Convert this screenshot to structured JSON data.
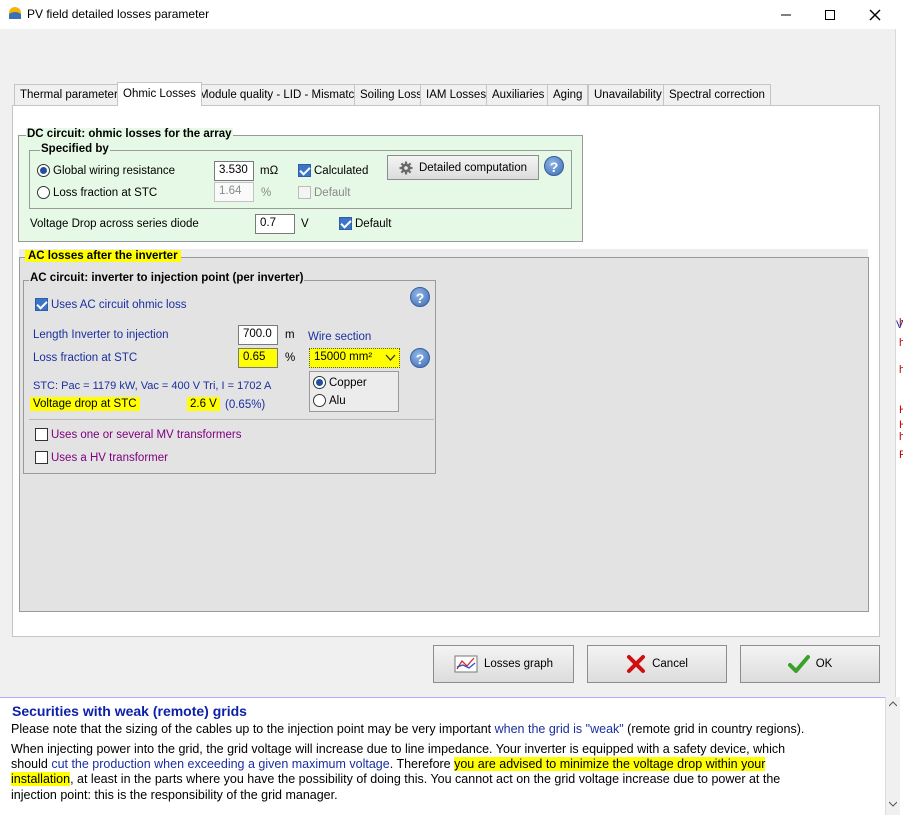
{
  "window": {
    "title": "PV field detailed losses parameter",
    "minimize_glyph": "—",
    "maximize_glyph": "☐",
    "close_glyph": "X"
  },
  "tabs": [
    {
      "label": "Thermal parameter",
      "active": false
    },
    {
      "label": "Ohmic Losses",
      "active": true
    },
    {
      "label": "Module quality - LID - Mismatch",
      "active": false
    },
    {
      "label": "Soiling Loss",
      "active": false
    },
    {
      "label": "IAM Losses",
      "active": false
    },
    {
      "label": "Auxiliaries",
      "active": false
    },
    {
      "label": "Aging",
      "active": false
    },
    {
      "label": "Unavailability",
      "active": false
    },
    {
      "label": "Spectral correction",
      "active": false
    }
  ],
  "dc": {
    "group_title": "DC circuit: ohmic losses for the array",
    "specified_by_title": "Specified by",
    "global_wiring_label": "Global wiring resistance",
    "global_wiring_value": "3.530",
    "global_wiring_unit": "mΩ",
    "calculated_label": "Calculated",
    "detailed_button_label": "Detailed computation",
    "loss_fraction_label": "Loss fraction at STC",
    "loss_fraction_value": "1.64",
    "loss_fraction_unit": "%",
    "default_label": "Default",
    "diode_label": "Voltage Drop across series diode",
    "diode_value": "0.7",
    "diode_unit": "V",
    "diode_default_label": "Default"
  },
  "ac": {
    "group_title": "AC losses after the inverter",
    "circuit_title": "AC circuit: inverter to injection point  (per inverter)",
    "uses_ac_label": "Uses AC circuit ohmic loss",
    "length_label": "Length Inverter to injection",
    "length_value": "700.0",
    "length_unit": "m",
    "wire_section_label": "Wire section",
    "loss_fraction_label": "Loss fraction at STC",
    "loss_fraction_value": "0.65",
    "loss_fraction_unit": "%",
    "wire_section_value": "15000 mm²",
    "copper_label": "Copper",
    "alu_label": "Alu",
    "stc_text": "STC: Pac = 1179 kW,  Vac = 400 V Tri,  I = 1702 A",
    "vdrop_label": "Voltage drop at STC",
    "vdrop_value": "2.6 V",
    "vdrop_pct": "(0.65%)",
    "mv_label": "Uses one or several MV transformers",
    "hv_label": "Uses a HV transformer"
  },
  "buttons": {
    "losses_graph": "Losses graph",
    "cancel": "Cancel",
    "ok": "OK"
  },
  "side_strip": [
    "h",
    "h",
    "h",
    "V",
    "H",
    "H",
    "h",
    "F"
  ],
  "info": {
    "title": "Securities with weak (remote) grids",
    "p1_a": "Please note that the sizing of the cables up to the injection point may be very important ",
    "p1_b": "when the grid is \"weak\"",
    "p1_c": " (remote grid in country regions).",
    "p2_l1": "When injecting power into the grid, the grid voltage will increase due to line impedance. Your inverter is equipped with a safety device, which",
    "p2_l2_a": "should ",
    "p2_l2_b": "cut the production when exceeding a given maximum voltage",
    "p2_l2_c": ". Therefore ",
    "p2_l2_d": "you are advised to minimize the voltage drop within your",
    "p2_l3_a": "installation",
    "p2_l3_b": ", at least in the parts where you have the possibility of doing this. You cannot act on the grid voltage increase due to power at the",
    "p2_l4": "injection point: this is the responsibility of the grid manager."
  },
  "colors": {
    "highlight": "#ffff00",
    "info_title": "#0b1fa8",
    "link_blue": "#1a2fa0",
    "dc_background": "#e6f8e6",
    "ok_green": "#3aa02a",
    "cancel_red": "#d01010"
  }
}
